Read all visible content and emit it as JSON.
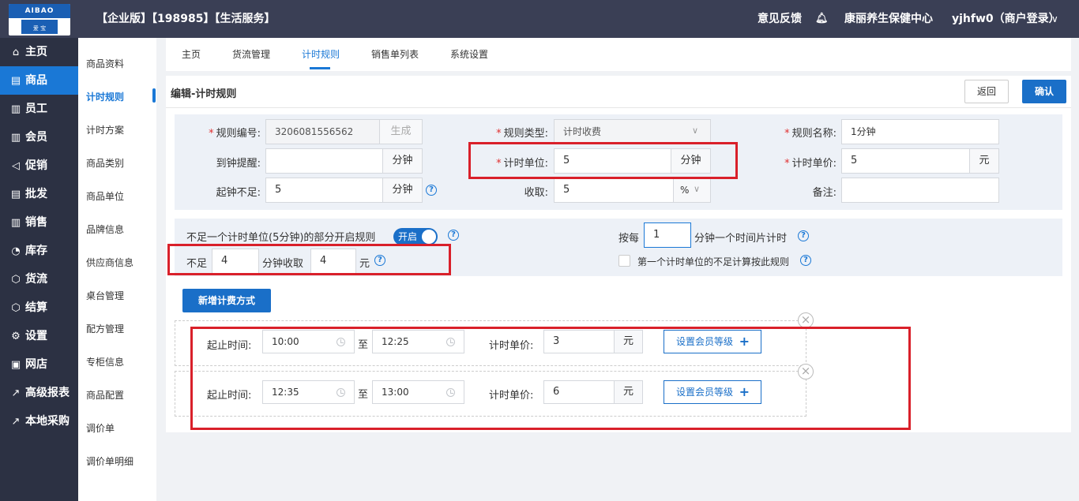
{
  "header": {
    "title": "【企业版】【198985】【生活服务】",
    "feedback": "意见反馈",
    "store": "康丽养生保健中心",
    "user": "yjhfw0（商户登录）",
    "logo_top": "AIBAO",
    "logo_bottom": "爱 宝"
  },
  "sidebar": {
    "items": [
      {
        "label": "主页",
        "icon": "⌂"
      },
      {
        "label": "商品",
        "icon": "▤"
      },
      {
        "label": "员工",
        "icon": "▥"
      },
      {
        "label": "会员",
        "icon": "▥"
      },
      {
        "label": "促销",
        "icon": "◁"
      },
      {
        "label": "批发",
        "icon": "▤"
      },
      {
        "label": "销售",
        "icon": "▥"
      },
      {
        "label": "库存",
        "icon": "◔"
      },
      {
        "label": "货流",
        "icon": "⬡"
      },
      {
        "label": "结算",
        "icon": "⬡"
      },
      {
        "label": "设置",
        "icon": "⚙"
      },
      {
        "label": "网店",
        "icon": "▣"
      },
      {
        "label": "高级报表",
        "icon": "↗"
      },
      {
        "label": "本地采购",
        "icon": "↗"
      }
    ]
  },
  "subnav": {
    "items": [
      "商品资料",
      "计时规则",
      "计时方案",
      "商品类别",
      "商品单位",
      "品牌信息",
      "供应商信息",
      "桌台管理",
      "配方管理",
      "专柜信息",
      "商品配置",
      "调价单",
      "调价单明细"
    ]
  },
  "tabs": [
    "主页",
    "货流管理",
    "计时规则",
    "销售单列表",
    "系统设置"
  ],
  "page": {
    "heading": "编辑-计时规则",
    "back": "返回",
    "confirm": "确认"
  },
  "form": {
    "rule_no_label": "规则编号:",
    "rule_no": "3206081556562",
    "generate": "生成",
    "rule_type_label": "规则类型:",
    "rule_type": "计时收费",
    "rule_name_label": "规则名称:",
    "rule_name": "1分钟",
    "remind_label": "到钟提醒:",
    "remind": "",
    "minute_unit": "分钟",
    "time_unit_label": "计时单位:",
    "time_unit": "5",
    "unit_price_label": "计时单价:",
    "unit_price": "5",
    "yuan": "元",
    "min_start_label": "起钟不足:",
    "min_start": "5",
    "charge_label": "收取:",
    "charge": "5",
    "percent": "%",
    "remark_label": "备注:",
    "remark": ""
  },
  "partial": {
    "rule_label": "不足一个计时单位(5分钟)的部分开启规则",
    "toggle": "开启",
    "per_label": "按每",
    "per_value": "1",
    "per_suffix": "分钟一个时间片计时",
    "short_label": "不足",
    "short_value": "4",
    "short_mid": "分钟收取",
    "short_fee": "4",
    "short_yuan": "元",
    "first_unit_label": "第一个计时单位的不足计算按此规则"
  },
  "add_charge": "新增计费方式",
  "periods": [
    {
      "range_label": "起止时间:",
      "start": "10:00",
      "to": "至",
      "end": "12:25",
      "price_label": "计时单价:",
      "price": "3",
      "yuan": "元",
      "member": "设置会员等级"
    },
    {
      "range_label": "起止时间:",
      "start": "12:35",
      "to": "至",
      "end": "13:00",
      "price_label": "计时单价:",
      "price": "6",
      "yuan": "元",
      "member": "设置会员等级"
    }
  ],
  "colors": {
    "accent": "#1a6fc8",
    "sidebar": "#2c3143",
    "topbar": "#3a3f55",
    "highlight": "#d9202a"
  }
}
